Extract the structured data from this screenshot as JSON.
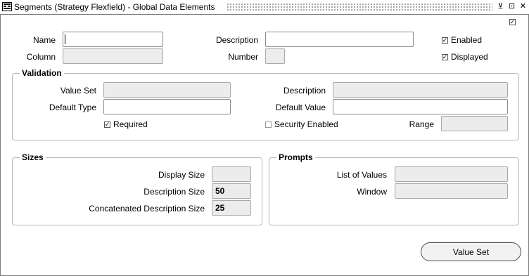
{
  "window": {
    "title": "Segments (Strategy Flexfield) - Global Data Elements",
    "controls": {
      "minimize": "⊻",
      "maximize": "⊡",
      "close": "✕"
    }
  },
  "top_checkbox": {
    "checked": true,
    "mark": "✓"
  },
  "segment": {
    "name_label": "Name",
    "name_value": "",
    "column_label": "Column",
    "column_value": "",
    "description_label": "Description",
    "description_value": "",
    "number_label": "Number",
    "number_value": "",
    "enabled_label": "Enabled",
    "enabled_checked": true,
    "displayed_label": "Displayed",
    "displayed_checked": true
  },
  "validation": {
    "title": "Validation",
    "value_set_label": "Value Set",
    "value_set_value": "",
    "description_label": "Description",
    "description_value": "",
    "default_type_label": "Default Type",
    "default_type_value": "",
    "default_value_label": "Default Value",
    "default_value_value": "",
    "required_label": "Required",
    "required_checked": true,
    "security_label": "Security Enabled",
    "security_checked": false,
    "range_label": "Range",
    "range_value": ""
  },
  "sizes": {
    "title": "Sizes",
    "display_size_label": "Display Size",
    "display_size_value": "",
    "description_size_label": "Description Size",
    "description_size_value": "50",
    "concat_size_label": "Concatenated Description Size",
    "concat_size_value": "25"
  },
  "prompts": {
    "title": "Prompts",
    "list_of_values_label": "List of Values",
    "list_of_values_value": "",
    "window_label": "Window",
    "window_value": ""
  },
  "buttons": {
    "value_set": "Value Set"
  },
  "marks": {
    "check": "✓"
  }
}
